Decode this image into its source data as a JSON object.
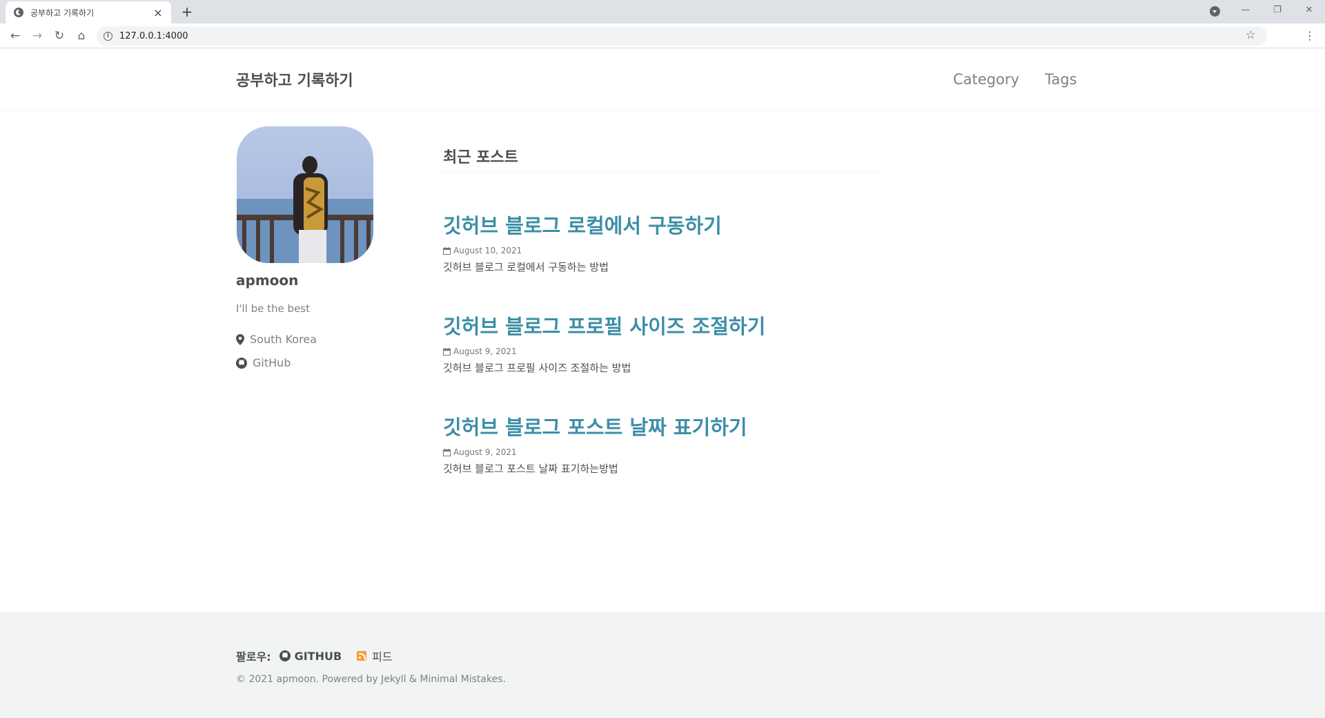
{
  "browser": {
    "tab_title": "공부하고 기록하기",
    "tab_close": "×",
    "new_tab": "+",
    "url": "127.0.0.1:4000",
    "controls": {
      "minimize": "—",
      "restore": "❐",
      "close": "✕"
    },
    "nav": {
      "back": "←",
      "forward": "→",
      "reload": "↻",
      "home": "⌂",
      "star": "☆",
      "menu": "⋮"
    }
  },
  "site": {
    "title": "공부하고 기록하기",
    "nav": [
      {
        "label": "Category"
      },
      {
        "label": "Tags"
      }
    ]
  },
  "author": {
    "name": "apmoon",
    "bio": "I'll be the best",
    "location": "South Korea",
    "github": "GitHub"
  },
  "main": {
    "section_title": "최근 포스트",
    "posts": [
      {
        "title": "깃허브 블로그 로컬에서 구동하기",
        "date": "August 10, 2021",
        "excerpt": "깃허브 블로그 로컬에서 구동하는 방법"
      },
      {
        "title": "깃허브 블로그 프로필 사이즈 조절하기",
        "date": "August 9, 2021",
        "excerpt": "깃허브 블로그 프로필 사이즈 조절하는 방법"
      },
      {
        "title": "깃허브 블로그 포스트 날짜 표기하기",
        "date": "August 9, 2021",
        "excerpt": "깃허브 블로그 포스트 날짜 표기하는방법"
      }
    ]
  },
  "footer": {
    "follow_label": "팔로우:",
    "github_label": "GITHUB",
    "feed_label": "피드",
    "copyright": "© 2021 apmoon. Powered by Jekyll & Minimal Mistakes."
  },
  "colors": {
    "accent": "#3b8ea5",
    "text": "#494e52",
    "muted": "#7a8288",
    "footer_bg": "#f2f3f3"
  }
}
